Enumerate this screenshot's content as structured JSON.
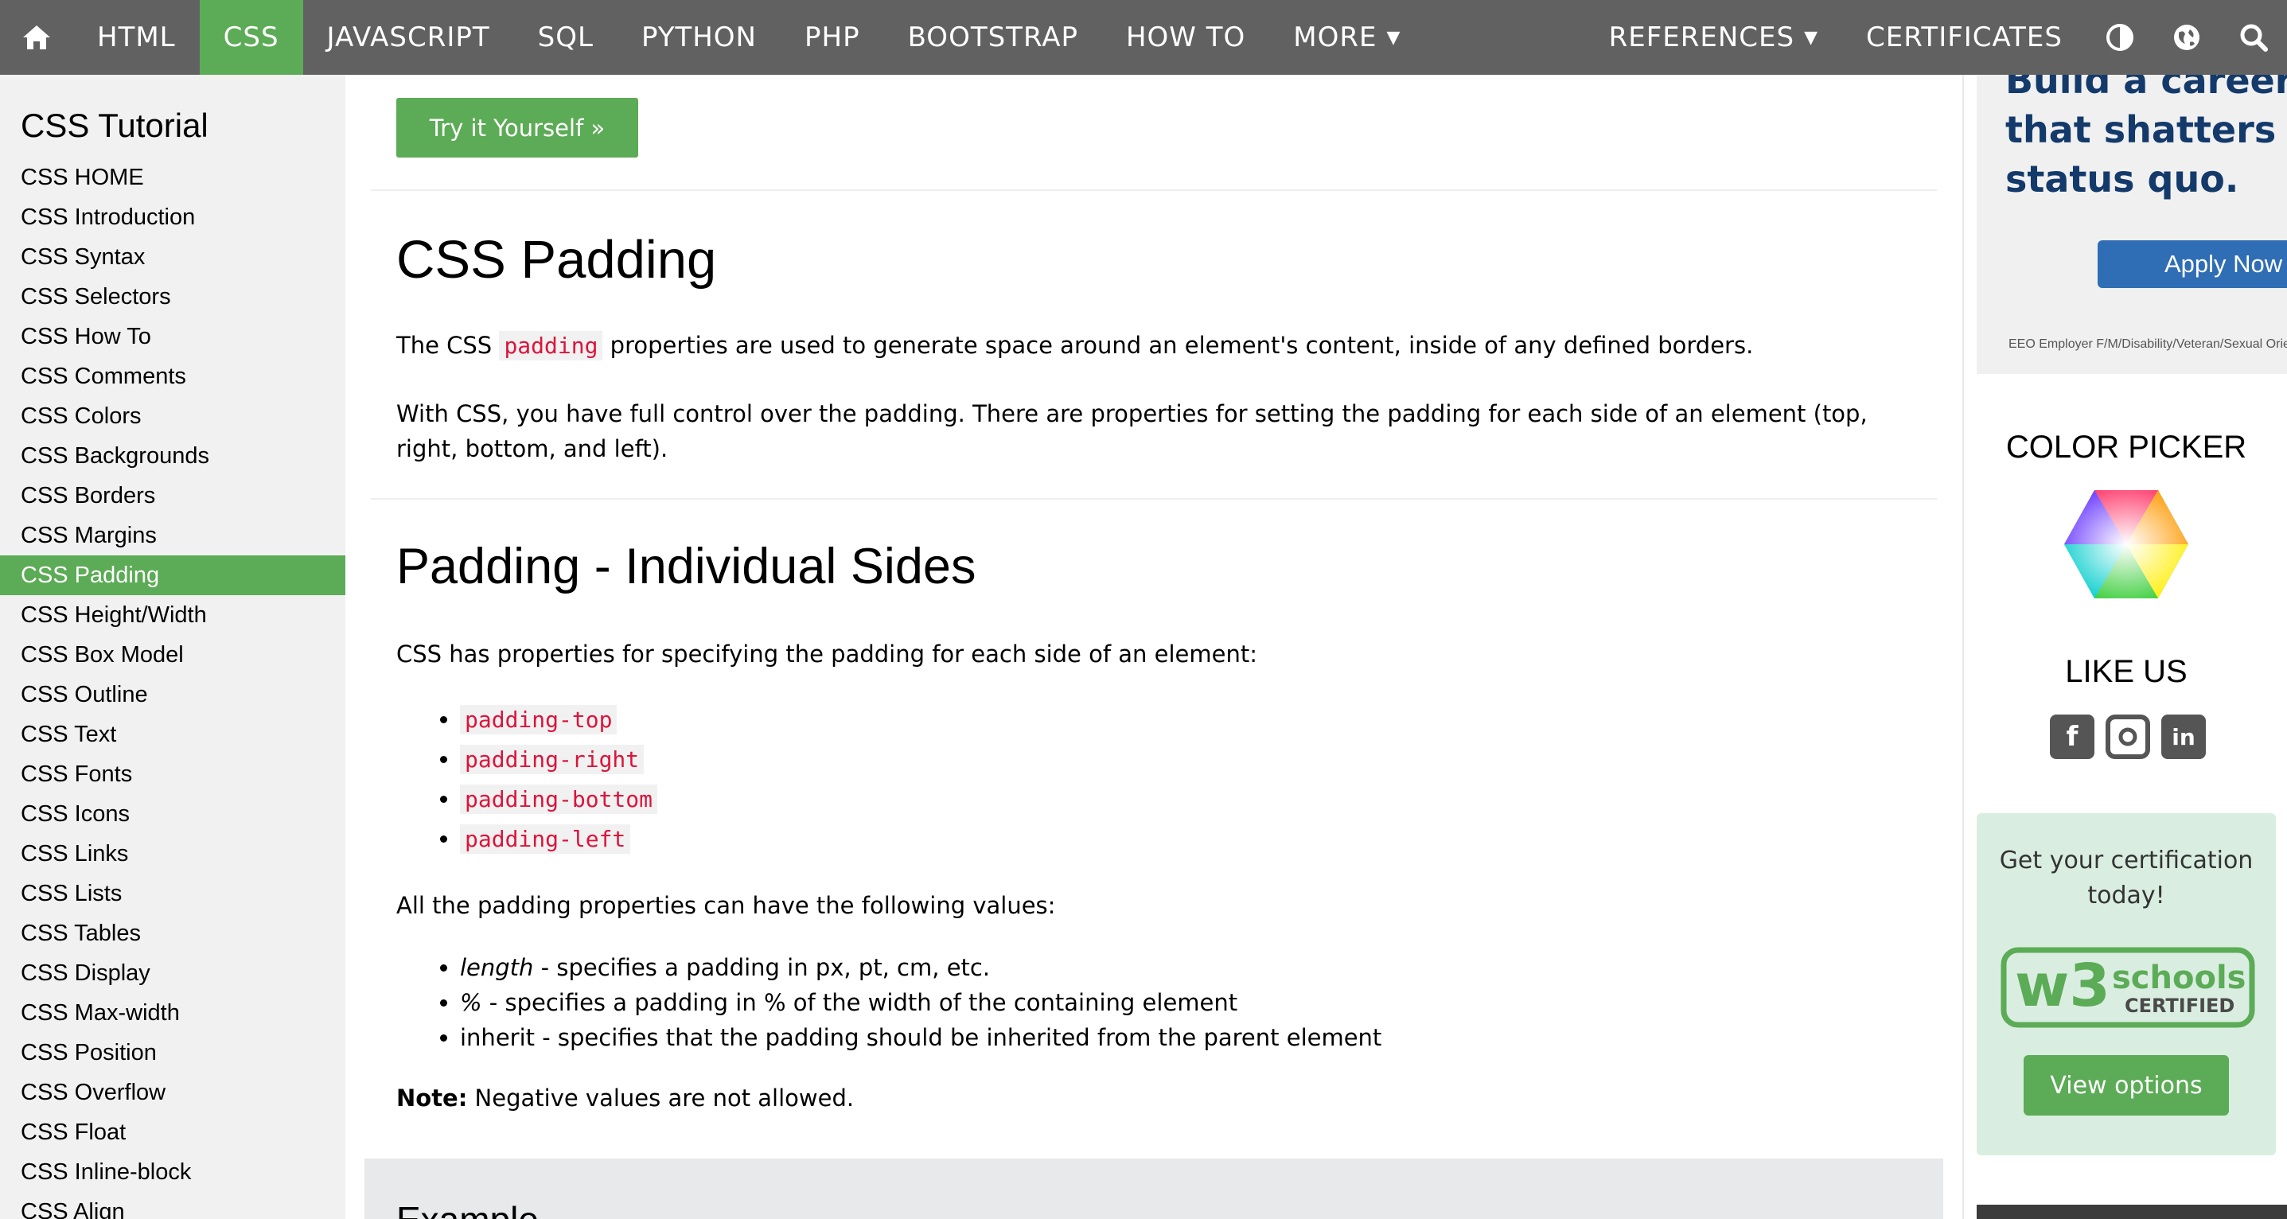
{
  "nav": {
    "items": [
      "HTML",
      "CSS",
      "JAVASCRIPT",
      "SQL",
      "PYTHON",
      "PHP",
      "BOOTSTRAP",
      "HOW TO"
    ],
    "more": "MORE",
    "references": "REFERENCES",
    "certificates": "CERTIFICATES",
    "active": "CSS",
    "icons": [
      "home-icon",
      "contrast-icon",
      "globe-icon",
      "search-icon"
    ]
  },
  "sidebar": {
    "title": "CSS Tutorial",
    "items": [
      "CSS HOME",
      "CSS Introduction",
      "CSS Syntax",
      "CSS Selectors",
      "CSS How To",
      "CSS Comments",
      "CSS Colors",
      "CSS Backgrounds",
      "CSS Borders",
      "CSS Margins",
      "CSS Padding",
      "CSS Height/Width",
      "CSS Box Model",
      "CSS Outline",
      "CSS Text",
      "CSS Fonts",
      "CSS Icons",
      "CSS Links",
      "CSS Lists",
      "CSS Tables",
      "CSS Display",
      "CSS Max-width",
      "CSS Position",
      "CSS Overflow",
      "CSS Float",
      "CSS Inline-block",
      "CSS Align"
    ],
    "active_index": 10
  },
  "main": {
    "try_button": "Try it Yourself »",
    "h1": "CSS Padding",
    "p1_before": "The CSS ",
    "p1_code": "padding",
    "p1_after": " properties are used to generate space around an element's content, inside of any defined borders.",
    "p2": "With CSS, you have full control over the padding. There are properties for setting the padding for each side of an element (top, right, bottom, and left).",
    "h2": "Padding - Individual Sides",
    "p3": "CSS has properties for specifying the padding for each side of an element:",
    "props": [
      "padding-top",
      "padding-right",
      "padding-bottom",
      "padding-left"
    ],
    "p4": "All the padding properties can have the following values:",
    "values": [
      {
        "term": "length",
        "rest": " - specifies a padding in px, pt, cm, etc.",
        "italic": true
      },
      {
        "term": "%",
        "rest": " - specifies a padding in % of the width of the containing element",
        "italic": true
      },
      {
        "term": "inherit",
        "rest": " - specifies that the padding should be inherited from the parent element",
        "italic": false
      }
    ],
    "note_label": "Note:",
    "note_text": " Negative values are not allowed.",
    "example_title": "Example"
  },
  "right": {
    "ad_headline": [
      "Build a career",
      "that shatters th",
      "status quo."
    ],
    "ad_button": "Apply Now",
    "ad_fine": "EEO Employer F/M/Disability/Veteran/Sexual Orie",
    "color_picker_title": "COLOR PICKER",
    "like_us_title": "LIKE US",
    "social": [
      "facebook-icon",
      "instagram-icon",
      "linkedin-icon"
    ],
    "cert_text": "Get your certification today!",
    "cert_logo": "w3schools CERTIFIED",
    "view_options": "View options"
  },
  "colors": {
    "nav_bg": "#616161",
    "accent_green": "#5cab56",
    "sidebar_bg": "#f1f1f1",
    "code_red": "#dc143c",
    "cert_bg": "#d9eee1"
  }
}
